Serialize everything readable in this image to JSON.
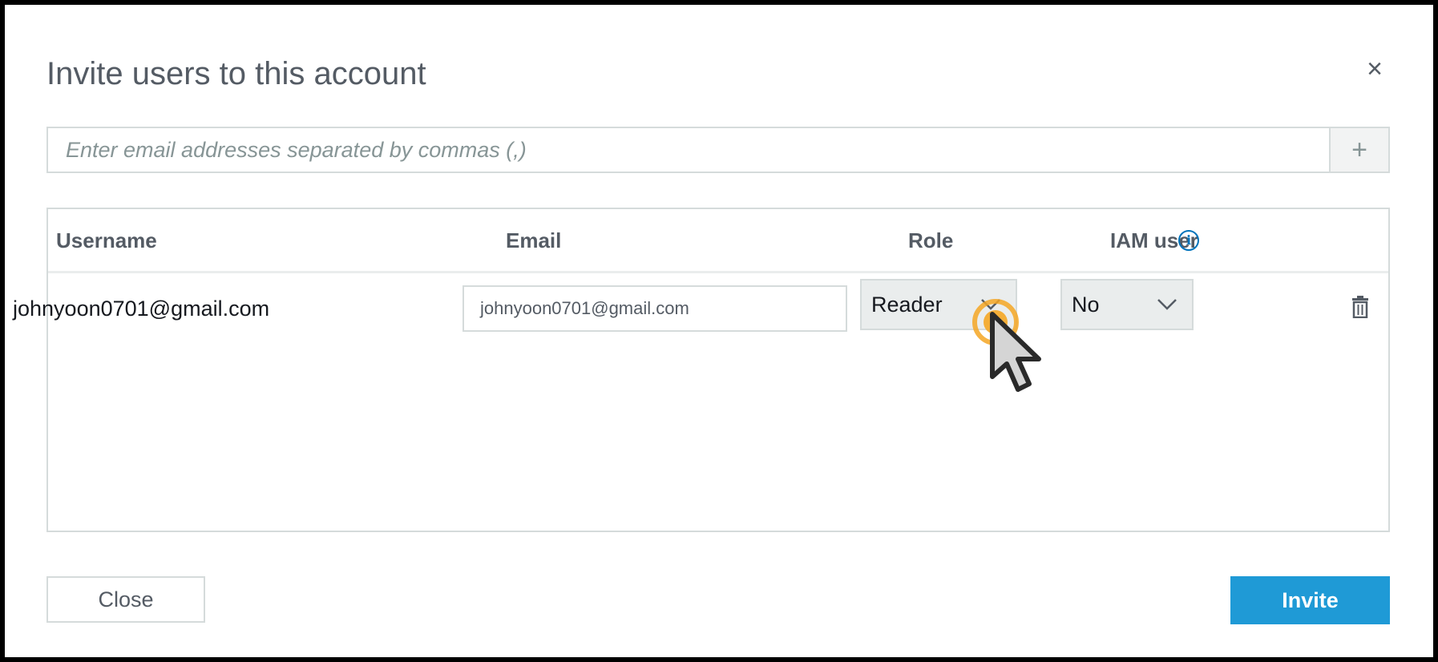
{
  "dialog": {
    "title": "Invite users to this account",
    "close_glyph": "×"
  },
  "email_entry": {
    "placeholder": "Enter email addresses separated by commas (,)",
    "value": "",
    "add_glyph": "+"
  },
  "table": {
    "columns": [
      "Username",
      "Email",
      "Role",
      "IAM user"
    ],
    "rows": [
      {
        "username": "johnyoon0701@gmail.com",
        "email": "johnyoon0701@gmail.com",
        "role": "Reader",
        "iam_user": "No"
      }
    ]
  },
  "icons": {
    "info": "info-icon",
    "delete": "trash-icon",
    "close": "close-icon",
    "add": "plus-icon",
    "dropdown": "chevron-down-icon"
  },
  "footer": {
    "close_label": "Close",
    "invite_label": "Invite"
  },
  "colors": {
    "accent": "#1f9ad6",
    "info": "#0073bb",
    "cursor_highlight": "#f5a623"
  }
}
